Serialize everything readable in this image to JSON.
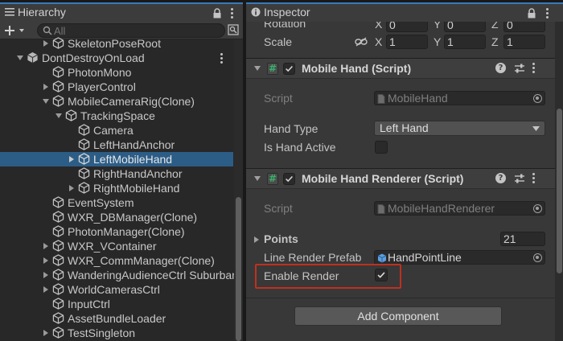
{
  "hierarchy": {
    "tab_label": "Hierarchy",
    "search_placeholder": "All",
    "rows": [
      {
        "label": "SkeletonPoseRoot"
      },
      {
        "label": "DontDestroyOnLoad"
      },
      {
        "label": "PhotonMono"
      },
      {
        "label": "PlayerControl"
      },
      {
        "label": "MobileCameraRig(Clone)"
      },
      {
        "label": "TrackingSpace"
      },
      {
        "label": "Camera"
      },
      {
        "label": "LeftHandAnchor"
      },
      {
        "label": "LeftMobileHand"
      },
      {
        "label": "RightHandAnchor"
      },
      {
        "label": "RightMobileHand"
      },
      {
        "label": "EventSystem"
      },
      {
        "label": "WXR_DBManager(Clone)"
      },
      {
        "label": "PhotonManager(Clone)"
      },
      {
        "label": "WXR_VContainer"
      },
      {
        "label": "WXR_CommManager(Clone)"
      },
      {
        "label": "WanderingAudienceCtrl Suburban"
      },
      {
        "label": "WorldCamerasCtrl"
      },
      {
        "label": "InputCtrl"
      },
      {
        "label": "AssetBundleLoader"
      },
      {
        "label": "TestSingleton"
      }
    ]
  },
  "inspector": {
    "tab_label": "Inspector",
    "rotation": {
      "label": "Rotation",
      "x_label": "X",
      "x": "0",
      "y_label": "Y",
      "y": "0",
      "z_label": "Z",
      "z": "0"
    },
    "scale": {
      "label": "Scale",
      "x_label": "X",
      "x": "1",
      "y_label": "Y",
      "y": "1",
      "z_label": "Z",
      "z": "1"
    },
    "mobile_hand": {
      "title": "Mobile Hand (Script)",
      "script_label": "Script",
      "script_value": "MobileHand",
      "hand_type_label": "Hand Type",
      "hand_type_value": "Left Hand",
      "is_active_label": "Is Hand Active"
    },
    "renderer": {
      "title": "Mobile Hand Renderer (Script)",
      "script_label": "Script",
      "script_value": "MobileHandRenderer",
      "points_label": "Points",
      "points_value": "21",
      "prefab_label": "Line Render Prefab",
      "prefab_value": "HandPointLine",
      "enable_label": "Enable Render"
    },
    "add_component_label": "Add Component"
  },
  "colors": {
    "selection": "#2c5d87",
    "tab_accent": "#3a79bb",
    "highlight": "#c0301f"
  }
}
